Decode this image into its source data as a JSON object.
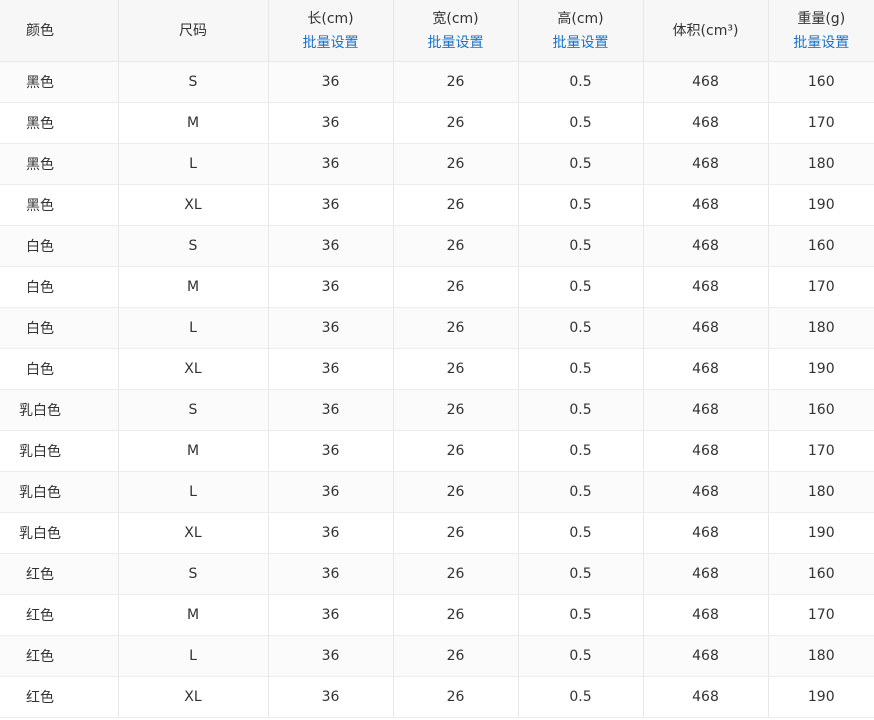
{
  "table": {
    "headers": [
      {
        "label": "颜色",
        "batch": ""
      },
      {
        "label": "尺码",
        "batch": ""
      },
      {
        "label": "长(cm)",
        "batch": "批量设置"
      },
      {
        "label": "宽(cm)",
        "batch": "批量设置"
      },
      {
        "label": "高(cm)",
        "batch": "批量设置"
      },
      {
        "label": "体积(cm³)",
        "batch": ""
      },
      {
        "label": "重量(g)",
        "batch": "批量设置"
      }
    ],
    "rows": [
      [
        "黑色",
        "S",
        "36",
        "26",
        "0.5",
        "468",
        "160"
      ],
      [
        "黑色",
        "M",
        "36",
        "26",
        "0.5",
        "468",
        "170"
      ],
      [
        "黑色",
        "L",
        "36",
        "26",
        "0.5",
        "468",
        "180"
      ],
      [
        "黑色",
        "XL",
        "36",
        "26",
        "0.5",
        "468",
        "190"
      ],
      [
        "白色",
        "S",
        "36",
        "26",
        "0.5",
        "468",
        "160"
      ],
      [
        "白色",
        "M",
        "36",
        "26",
        "0.5",
        "468",
        "170"
      ],
      [
        "白色",
        "L",
        "36",
        "26",
        "0.5",
        "468",
        "180"
      ],
      [
        "白色",
        "XL",
        "36",
        "26",
        "0.5",
        "468",
        "190"
      ],
      [
        "乳白色",
        "S",
        "36",
        "26",
        "0.5",
        "468",
        "160"
      ],
      [
        "乳白色",
        "M",
        "36",
        "26",
        "0.5",
        "468",
        "170"
      ],
      [
        "乳白色",
        "L",
        "36",
        "26",
        "0.5",
        "468",
        "180"
      ],
      [
        "乳白色",
        "XL",
        "36",
        "26",
        "0.5",
        "468",
        "190"
      ],
      [
        "红色",
        "S",
        "36",
        "26",
        "0.5",
        "468",
        "160"
      ],
      [
        "红色",
        "M",
        "36",
        "26",
        "0.5",
        "468",
        "170"
      ],
      [
        "红色",
        "L",
        "36",
        "26",
        "0.5",
        "468",
        "180"
      ],
      [
        "红色",
        "XL",
        "36",
        "26",
        "0.5",
        "468",
        "190"
      ]
    ]
  },
  "colors": {
    "link": "#1a73c8",
    "header_bg": "#f7f7f7",
    "border": "#e8e8e8",
    "text": "#333333"
  }
}
